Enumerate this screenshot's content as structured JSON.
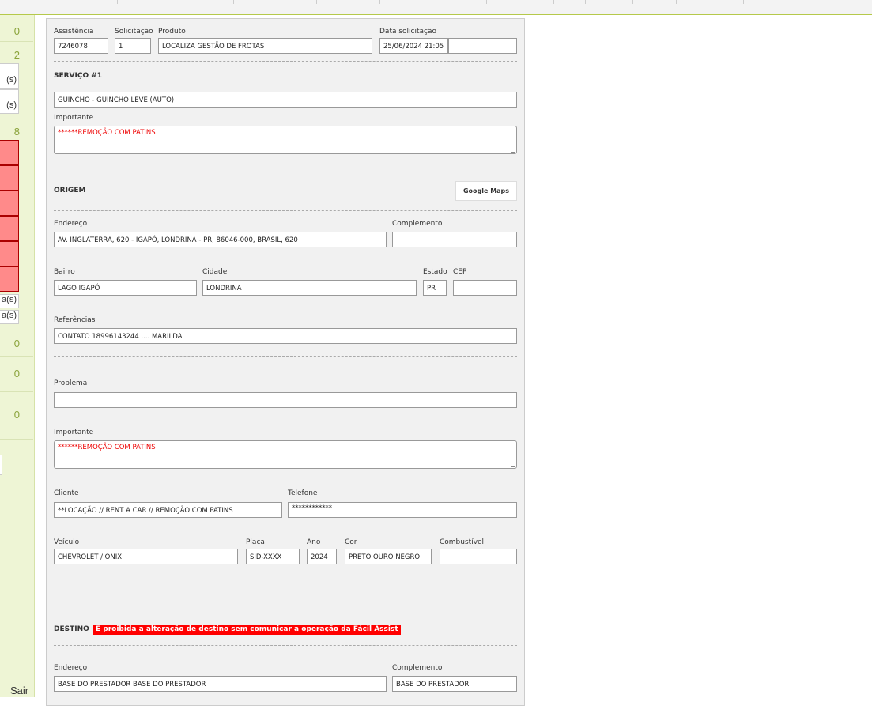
{
  "sidebar": {
    "counts": [
      "0",
      "2",
      "8",
      "0",
      "0",
      "0"
    ],
    "boxes": [
      "(s)",
      "(s)",
      "a(s)",
      "a(s)"
    ],
    "logout": "Sair"
  },
  "header": {
    "assistencia_label": "Assistência",
    "assistencia": "7246078",
    "solicitacao_label": "Solicitação",
    "solicitacao": "1",
    "produto_label": "Produto",
    "produto": "LOCALIZA GESTÃO DE FROTAS",
    "data_label": "Data solicitação",
    "data": "25/06/2024 21:05",
    "data_extra": ""
  },
  "servico": {
    "title": "SERVIÇO #1",
    "tipo": "GUINCHO - GUINCHO LEVE (AUTO)",
    "importante_label": "Importante",
    "importante": "******REMOÇÃO COM PATINS"
  },
  "origem": {
    "title": "ORIGEM",
    "maps_button": "Google Maps",
    "endereco_label": "Endereço",
    "endereco": "AV. INGLATERRA, 620 - IGAPÓ, LONDRINA - PR, 86046-000, BRASIL, 620",
    "complemento_label": "Complemento",
    "complemento": "",
    "bairro_label": "Bairro",
    "bairro": "LAGO IGAPÓ",
    "cidade_label": "Cidade",
    "cidade": "LONDRINA",
    "estado_label": "Estado",
    "estado": "PR",
    "cep_label": "CEP",
    "cep": "",
    "referencias_label": "Referências",
    "referencias": "CONTATO 18996143244 .... MARILDA"
  },
  "problema": {
    "label": "Problema",
    "value": "",
    "importante_label": "Importante",
    "importante": "******REMOÇÃO COM PATINS"
  },
  "cliente": {
    "cliente_label": "Cliente",
    "cliente": "**LOCAÇÃO //  RENT A CAR  //  REMOÇÃO  COM PATINS",
    "telefone_label": "Telefone",
    "telefone": "************",
    "veiculo_label": "Veículo",
    "veiculo": "CHEVROLET / ONIX",
    "placa_label": "Placa",
    "placa": "SID-XXXX",
    "ano_label": "Ano",
    "ano": "2024",
    "cor_label": "Cor",
    "cor": "PRETO OURO NEGRO",
    "combustivel_label": "Combustível",
    "combustivel": ""
  },
  "destino": {
    "title": "DESTINO",
    "warning": "É proibida a alteração de destino sem comunicar a operação da Fácil Assist",
    "endereco_label": "Endereço",
    "endereco": "BASE DO PRESTADOR BASE DO PRESTADOR",
    "complemento_label": "Complemento",
    "complemento": "BASE DO PRESTADOR"
  }
}
